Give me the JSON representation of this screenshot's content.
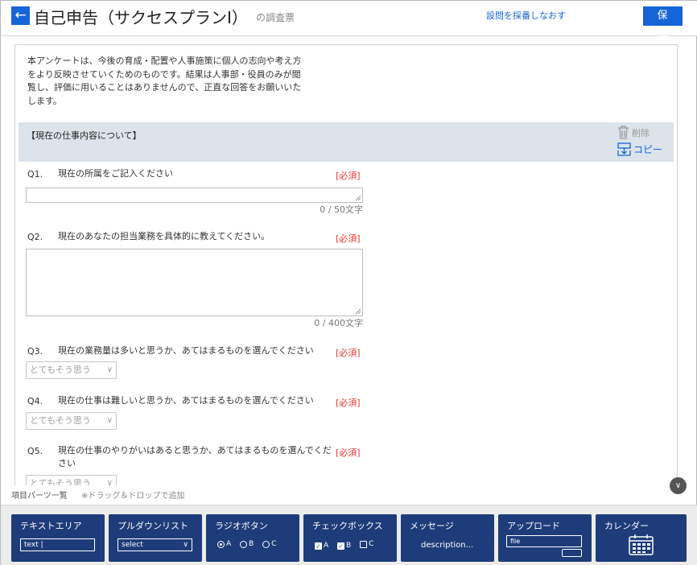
{
  "header": {
    "back_icon": "arrow-left-icon",
    "title": "自己申告（サクセスプランI）",
    "subtitle": "の調査票",
    "renumber_link": "設問を採番しなおす",
    "save_label": "保 存",
    "accent_color": "#1565d8"
  },
  "intro_text": "本アンケートは、今後の育成・配置や人事施策に個人の志向や考え方をより反映させていくためのものです。結果は人事部・役員のみが閲覧し、評価に用いることはありませんので、正直な回答をお願いいたします。",
  "section": {
    "title": "【現在の仕事内容について】",
    "delete_label": "削除",
    "copy_label": "コピー"
  },
  "questions": [
    {
      "number": "Q1.",
      "text": "現在の所属をご記入ください",
      "required": "[必須]",
      "input": "",
      "counter": "0 / 50文字"
    },
    {
      "number": "Q2.",
      "text": "現在のあなたの担当業務を具体的に教えてください。",
      "required": "[必須]",
      "input": "",
      "counter": "0 / 400文字"
    },
    {
      "number": "Q3.",
      "text": "現在の業務量は多いと思うか、あてはまるものを選んでください",
      "required": "[必須]",
      "selected": "とてもそう思う"
    },
    {
      "number": "Q4.",
      "text": "現在の仕事は難しいと思うか、あてはまるものを選んでください",
      "required": "[必須]",
      "selected": "とてもそう思う"
    },
    {
      "number": "Q5.",
      "text": "現在の仕事のやりがいはあると思うか、あてはまるものを選んでください",
      "required": "[必須]",
      "selected": "とてもそう思う"
    }
  ],
  "palette": {
    "label": "項目パーツ一覧",
    "note": "※ドラッグ＆ドロップで追加",
    "tiles": [
      {
        "title": "テキストエリア",
        "sample": "text |"
      },
      {
        "title": "プルダウンリスト",
        "sample": "select"
      },
      {
        "title": "ラジオボタン",
        "options": [
          "A",
          "B",
          "C"
        ]
      },
      {
        "title": "チェックボックス",
        "options": [
          "A",
          "B",
          "C"
        ]
      },
      {
        "title": "メッセージ",
        "sample": "description..."
      },
      {
        "title": "アップロード",
        "sample": "file"
      },
      {
        "title": "カレンダー"
      }
    ],
    "tile_color": "#1e3c7a",
    "required_color": "#e53935"
  }
}
